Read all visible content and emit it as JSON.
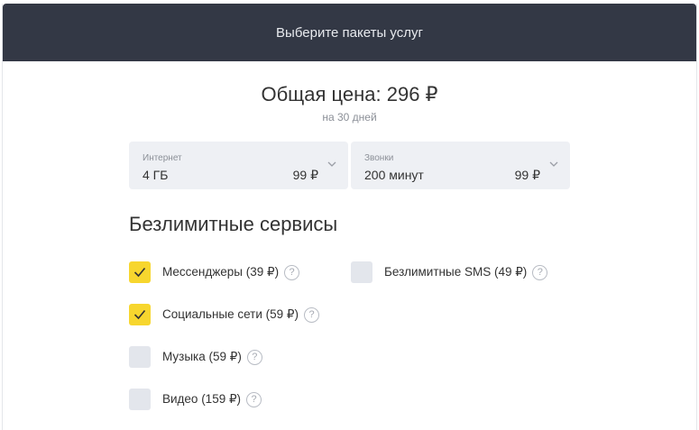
{
  "header": {
    "title": "Выберите пакеты услуг"
  },
  "price": {
    "total": "Общая цена: 296 ₽",
    "period": "на 30 дней"
  },
  "packages": [
    {
      "label": "Интернет",
      "value": "4 ГБ",
      "price": "99 ₽",
      "icon": "chevron-down-icon"
    },
    {
      "label": "Звонки",
      "value": "200 минут",
      "price": "99 ₽",
      "icon": "chevron-down-icon"
    }
  ],
  "unlimited": {
    "title": "Безлимитные сервисы",
    "help_glyph": "?",
    "options": [
      {
        "label": "Мессенджеры (39 ₽)",
        "checked": true
      },
      {
        "label": "Социальные сети (59 ₽)",
        "checked": true
      },
      {
        "label": "Музыка (59 ₽)",
        "checked": false
      },
      {
        "label": "Видео (159 ₽)",
        "checked": false
      },
      {
        "label": "Безлимитные SMS (49 ₽)",
        "checked": false
      }
    ]
  },
  "colors": {
    "header_bg": "#333845",
    "checkbox_checked": "#f7d62e",
    "checkbox_unchecked": "#e3e6ec",
    "dropdown_bg": "#eef0f4"
  }
}
